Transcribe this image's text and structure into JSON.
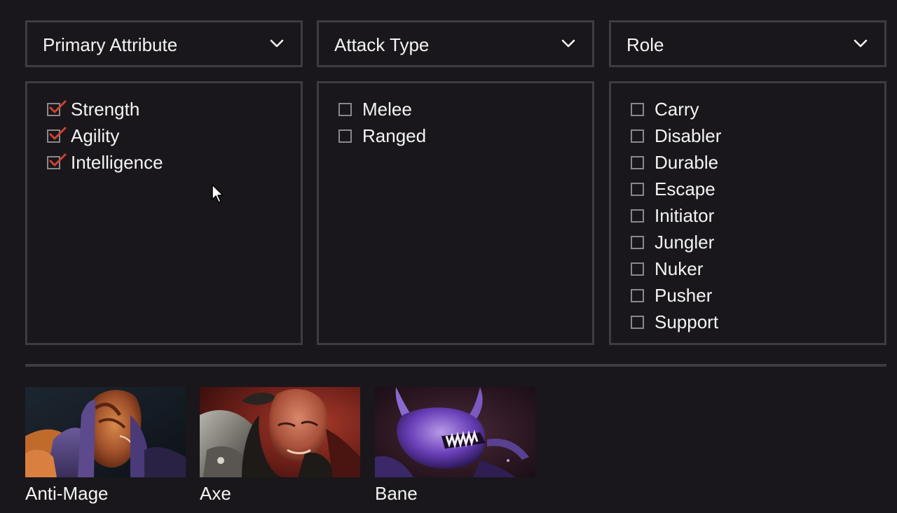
{
  "colors": {
    "background": "#19171b",
    "border": "#3e3c40",
    "text": "#f4f4f4",
    "checkmark": "#d0422f",
    "checkbox_border": "#8a888c"
  },
  "filters": [
    {
      "label": "Primary Attribute",
      "icon": "chevron-down-icon",
      "options": [
        {
          "label": "Strength",
          "checked": true
        },
        {
          "label": "Agility",
          "checked": true
        },
        {
          "label": "Intelligence",
          "checked": true
        }
      ]
    },
    {
      "label": "Attack Type",
      "icon": "chevron-down-icon",
      "options": [
        {
          "label": "Melee",
          "checked": false
        },
        {
          "label": "Ranged",
          "checked": false
        }
      ]
    },
    {
      "label": "Role",
      "icon": "chevron-down-icon",
      "options": [
        {
          "label": "Carry",
          "checked": false
        },
        {
          "label": "Disabler",
          "checked": false
        },
        {
          "label": "Durable",
          "checked": false
        },
        {
          "label": "Escape",
          "checked": false
        },
        {
          "label": "Initiator",
          "checked": false
        },
        {
          "label": "Jungler",
          "checked": false
        },
        {
          "label": "Nuker",
          "checked": false
        },
        {
          "label": "Pusher",
          "checked": false
        },
        {
          "label": "Support",
          "checked": false
        }
      ]
    }
  ],
  "heroes": [
    {
      "name": "Anti-Mage",
      "portrait": "anti-mage-portrait"
    },
    {
      "name": "Axe",
      "portrait": "axe-portrait"
    },
    {
      "name": "Bane",
      "portrait": "bane-portrait"
    }
  ]
}
